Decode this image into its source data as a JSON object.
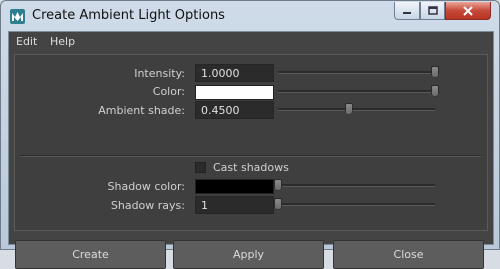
{
  "window": {
    "title": "Create Ambient Light Options",
    "icon": "maya-app-icon",
    "controls": {
      "minimize": "minimize-icon",
      "maximize": "maximize-icon",
      "close": "close-icon"
    }
  },
  "menu": {
    "items": [
      "Edit",
      "Help"
    ]
  },
  "options": {
    "intensity": {
      "label": "Intensity:",
      "value": "1.0000",
      "slider": 1.0
    },
    "color": {
      "label": "Color:",
      "value_color": "#ffffff",
      "slider": 1.0
    },
    "ambient_shade": {
      "label": "Ambient shade:",
      "value": "0.4500",
      "slider": 0.45
    },
    "cast_shadows": {
      "label": "Cast shadows",
      "checked": false
    },
    "shadow_color": {
      "label": "Shadow color:",
      "value_color": "#000000",
      "slider": 0.0
    },
    "shadow_rays": {
      "label": "Shadow rays:",
      "value": "1",
      "slider": 0.0
    }
  },
  "buttons": {
    "create": "Create",
    "apply": "Apply",
    "close": "Close"
  },
  "colors": {
    "panel_bg": "#444444",
    "field_bg": "#2b2b2b",
    "button_bg": "#5d5d5d",
    "titlebar": "#c7d5e4"
  }
}
